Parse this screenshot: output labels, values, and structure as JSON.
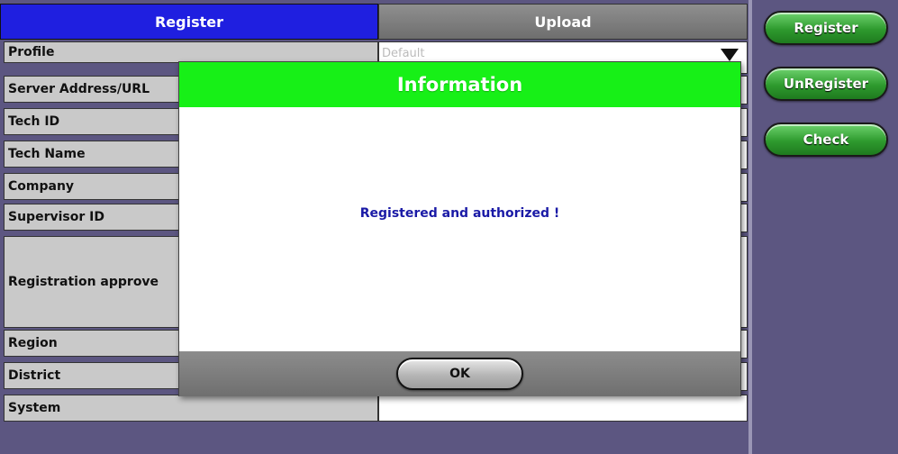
{
  "tabs": {
    "register": "Register",
    "upload": "Upload"
  },
  "form": {
    "rows": [
      {
        "label": "Profile"
      },
      {
        "label": "Server Address/URL"
      },
      {
        "label": "Tech ID"
      },
      {
        "label": "Tech Name"
      },
      {
        "label": "Company"
      },
      {
        "label": "Supervisor ID"
      },
      {
        "label": "Registration approve"
      },
      {
        "label": "Region"
      },
      {
        "label": "District"
      },
      {
        "label": "System"
      }
    ],
    "profile_value": "Default"
  },
  "sidebar": {
    "register": "Register",
    "unregister": "UnRegister",
    "check": "Check"
  },
  "dialog": {
    "title": "Information",
    "message": "Registered and authorized !",
    "ok": "OK"
  },
  "colors": {
    "active_tab": "#1f1fe0",
    "dialog_header": "#17f017",
    "background": "#5c5681",
    "side_button": "#2e9a2e"
  }
}
